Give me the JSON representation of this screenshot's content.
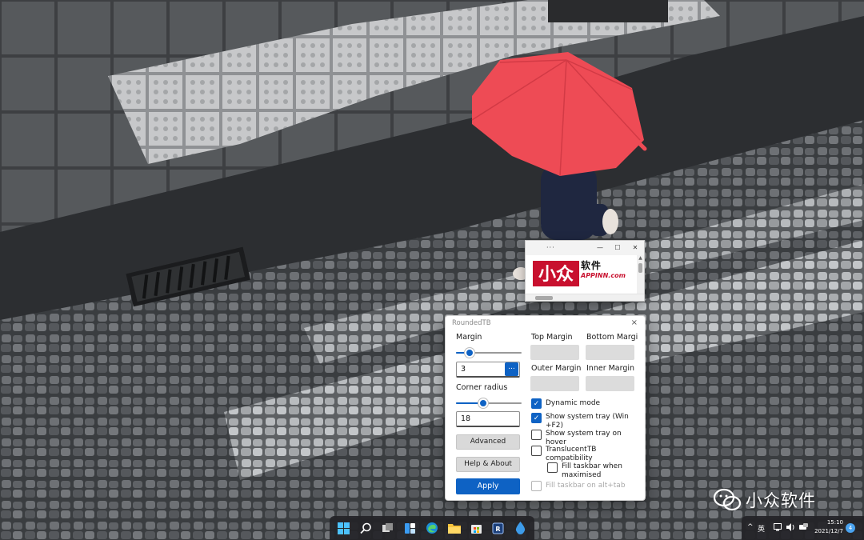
{
  "colors": {
    "accent": "#0e62c4",
    "umbrella": "#ee4b55",
    "logo_red": "#c8102e",
    "taskbar": "#242428"
  },
  "browser_window": {
    "logo_cn": "软件",
    "logo_en": "APPINN.com",
    "logo_mark_text": "小众"
  },
  "dialog": {
    "title": "RoundedTB",
    "close_icon": "×",
    "margin_label": "Margin",
    "margin_value": "3",
    "margin_slider": 0.15,
    "dots_label": "...",
    "corner_label": "Corner radius",
    "corner_value": "18",
    "corner_slider": 0.4,
    "advanced_label": "Advanced",
    "help_label": "Help & About",
    "apply_label": "Apply",
    "top_margin_label": "Top Margin",
    "bottom_margin_label": "Bottom Margi",
    "outer_margin_label": "Outer Margin",
    "inner_margin_label": "Inner Margin",
    "options": [
      {
        "label": "Dynamic mode",
        "checked": true,
        "enabled": true
      },
      {
        "label": "Show system tray (Win +F2)",
        "checked": true,
        "enabled": true
      },
      {
        "label": "Show system tray on hover",
        "checked": false,
        "enabled": true
      },
      {
        "label": "TranslucentTB compatibility",
        "checked": false,
        "enabled": true
      },
      {
        "label": "Fill taskbar when maximised",
        "checked": false,
        "enabled": true
      },
      {
        "label": "Fill taskbar on alt+tab",
        "checked": false,
        "enabled": false
      }
    ]
  },
  "taskbar": {
    "icons": [
      "windows-start-icon",
      "search-icon",
      "task-view-icon",
      "widgets-icon",
      "edge-icon",
      "file-explorer-icon",
      "store-icon",
      "roundedtb-icon",
      "drop-icon"
    ],
    "tray": {
      "chevron": "^",
      "ime": "英",
      "clock_time": "15:10",
      "clock_date": "2021/12/7",
      "notification_count": "4"
    }
  },
  "watermark": {
    "text": "小众软件"
  }
}
